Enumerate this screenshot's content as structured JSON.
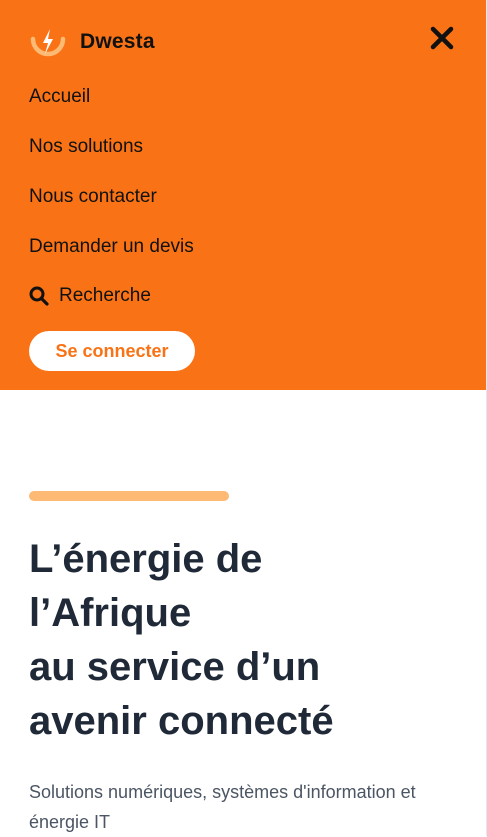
{
  "header": {
    "brand": "Dwesta",
    "logo_icon": "sun-lightning-logo",
    "close_icon": "close-icon"
  },
  "nav": {
    "items": [
      "Accueil",
      "Nos solutions",
      "Nous contacter",
      "Demander un devis"
    ],
    "search_label": "Recherche",
    "login_label": "Se connecter"
  },
  "hero": {
    "title_lines": [
      "L’énergie de",
      "l’Afrique",
      "au service d’un",
      "avenir connecté"
    ],
    "subtitle": "Solutions numériques, systèmes d'information et énergie IT"
  },
  "colors": {
    "brand_orange": "#f97316",
    "accent_bar": "#fdba74",
    "title_text": "#1f2937",
    "subtitle_text": "#4b5563"
  }
}
